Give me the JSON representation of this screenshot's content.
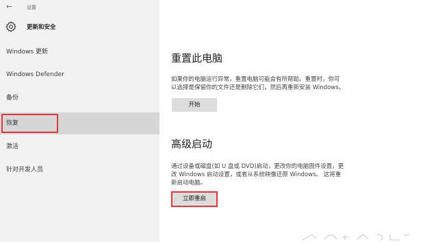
{
  "window": {
    "back_glyph": "←",
    "title": "设置"
  },
  "sidebar": {
    "section_title": "更新和安全",
    "section_icon": "gear-icon",
    "items": [
      {
        "label": "Windows 更新"
      },
      {
        "label": "Windows Defender"
      },
      {
        "label": "备份"
      },
      {
        "label": "恢复",
        "selected": true
      },
      {
        "label": "激活"
      },
      {
        "label": "针对开发人员"
      }
    ]
  },
  "main": {
    "reset": {
      "title": "重置此电脑",
      "description_line1": "如果你的电脑运行异常，重置电脑可能会有所帮助。重置时，你可",
      "description_line2": "以选择是保留你的文件还是删除它们，然后再重新安装 Windows。",
      "button": "开始"
    },
    "advanced": {
      "title": "高级启动",
      "description_line1": "通过设备或磁盘(如 U 盘或 DVD)启动，更改你的电脑固件设置，更",
      "description_line2": "改 Windows 启动设置，或者从系统映像还原 Windows。 这将重",
      "description_line3": "新启动电脑。",
      "button": "立即重启"
    }
  },
  "colors": {
    "sidebar_bg": "#f2f2f2",
    "selected_bg": "#d6d6d6",
    "highlight_red": "#e0373f",
    "button_bg": "#dcdcdc"
  }
}
